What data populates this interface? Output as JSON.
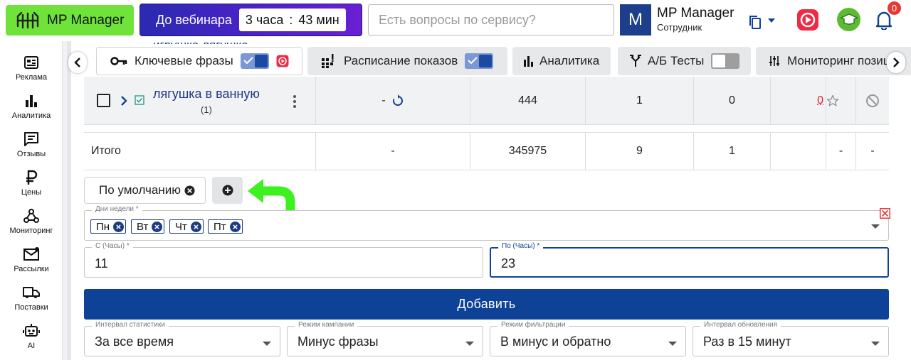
{
  "header": {
    "logo_text": "MP Manager",
    "webinar_label": "До вебинара",
    "timer_hours": "3 часа",
    "timer_sep": ":",
    "timer_minutes": "43 мин",
    "search_placeholder": "Есть вопросы по сервису?",
    "avatar_letter": "M",
    "user_name": "MP Manager",
    "user_role": "Сотрудник",
    "notifications_count": "0"
  },
  "sidebar": {
    "items": [
      {
        "label": "Реклама",
        "icon": "ad-icon"
      },
      {
        "label": "Аналитика",
        "icon": "bar-chart-icon"
      },
      {
        "label": "Отзывы",
        "icon": "comment-icon"
      },
      {
        "label": "Цены",
        "icon": "ruble-icon"
      },
      {
        "label": "Мониторинг",
        "icon": "network-icon"
      },
      {
        "label": "Рассылки",
        "icon": "mail-icon"
      },
      {
        "label": "Поставки",
        "icon": "truck-icon"
      },
      {
        "label": "AI",
        "icon": "robot-icon"
      }
    ]
  },
  "tabs": [
    {
      "label": "Ключевые фразы",
      "icon": "key-icon",
      "toggle": "on",
      "active": true
    },
    {
      "label": "Расписание показов",
      "icon": "grid-alert-icon",
      "toggle": "on",
      "active": false
    },
    {
      "label": "Аналитика",
      "icon": "bar-chart-icon",
      "active": false
    },
    {
      "label": "А/Б Тесты",
      "icon": "split-icon",
      "toggle": "off",
      "active": false
    },
    {
      "label": "Мониторинг позиций",
      "icon": "sliders-icon",
      "active": false
    }
  ],
  "table": {
    "ghost_text": "игрушка лягушка",
    "row": {
      "keyword": "лягушка в ванную",
      "count": "(1)",
      "position": "-",
      "views": "444",
      "col4": "1",
      "col5": "0",
      "col6": "0"
    },
    "total": {
      "label": "Итого",
      "position": "-",
      "views": "345975",
      "col4": "9",
      "col5": "1",
      "col6": "",
      "col7": "-",
      "col8": "-"
    }
  },
  "schedule": {
    "default_chip": "По умолчанию",
    "days_label": "Дни недели *",
    "days": [
      "Пн",
      "Вт",
      "Чт",
      "Пт"
    ],
    "from_label": "С (Часы) *",
    "from_value": "11",
    "to_label": "По (Часы) *",
    "to_value": "23",
    "add_button": "Добавить"
  },
  "filters": [
    {
      "label": "Интервал статистики",
      "value": "За все время"
    },
    {
      "label": "Режим кампании",
      "value": "Минус фразы"
    },
    {
      "label": "Режим фильтрации",
      "value": "В минус и обратно"
    },
    {
      "label": "Интервал обновления",
      "value": "Раз в 15 минут"
    }
  ],
  "colors": {
    "brand_green": "#6fe33a",
    "primary_blue": "#0e4296",
    "link_blue": "#1d3b84",
    "error_red": "#e53935",
    "arrow_green": "#3cf11e"
  }
}
